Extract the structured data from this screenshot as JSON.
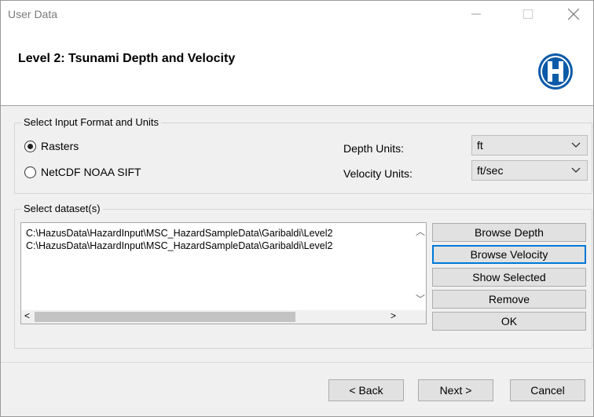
{
  "window": {
    "title": "User Data",
    "controls": {
      "minimize": "minimize-icon",
      "maximize": "maximize-icon",
      "close": "close-icon"
    }
  },
  "header": {
    "title": "Level 2: Tsunami Depth and Velocity",
    "logo": "hazus-h-logo"
  },
  "input_format": {
    "legend": "Select Input Format and Units",
    "options": [
      {
        "label": "Rasters",
        "selected": true
      },
      {
        "label": "NetCDF NOAA SIFT",
        "selected": false
      }
    ],
    "depth_units_label": "Depth Units:",
    "depth_units_value": "ft",
    "velocity_units_label": "Velocity Units:",
    "velocity_units_value": "ft/sec"
  },
  "dataset": {
    "legend": "Select dataset(s)",
    "items": [
      "C:\\HazusData\\HazardInput\\MSC_HazardSampleData\\Garibaldi\\Level2",
      "C:\\HazusData\\HazardInput\\MSC_HazardSampleData\\Garibaldi\\Level2"
    ],
    "buttons": {
      "browse_depth": "Browse Depth",
      "browse_velocity": "Browse Velocity",
      "show_selected": "Show Selected",
      "remove": "Remove",
      "ok": "OK"
    }
  },
  "footer": {
    "back": "< Back",
    "next": "Next >",
    "cancel": "Cancel"
  },
  "colors": {
    "logo_blue": "#0a5aa8",
    "focus_border": "#0078d7",
    "button_face": "#e1e1e1",
    "window_bg": "#f0f0f0"
  }
}
